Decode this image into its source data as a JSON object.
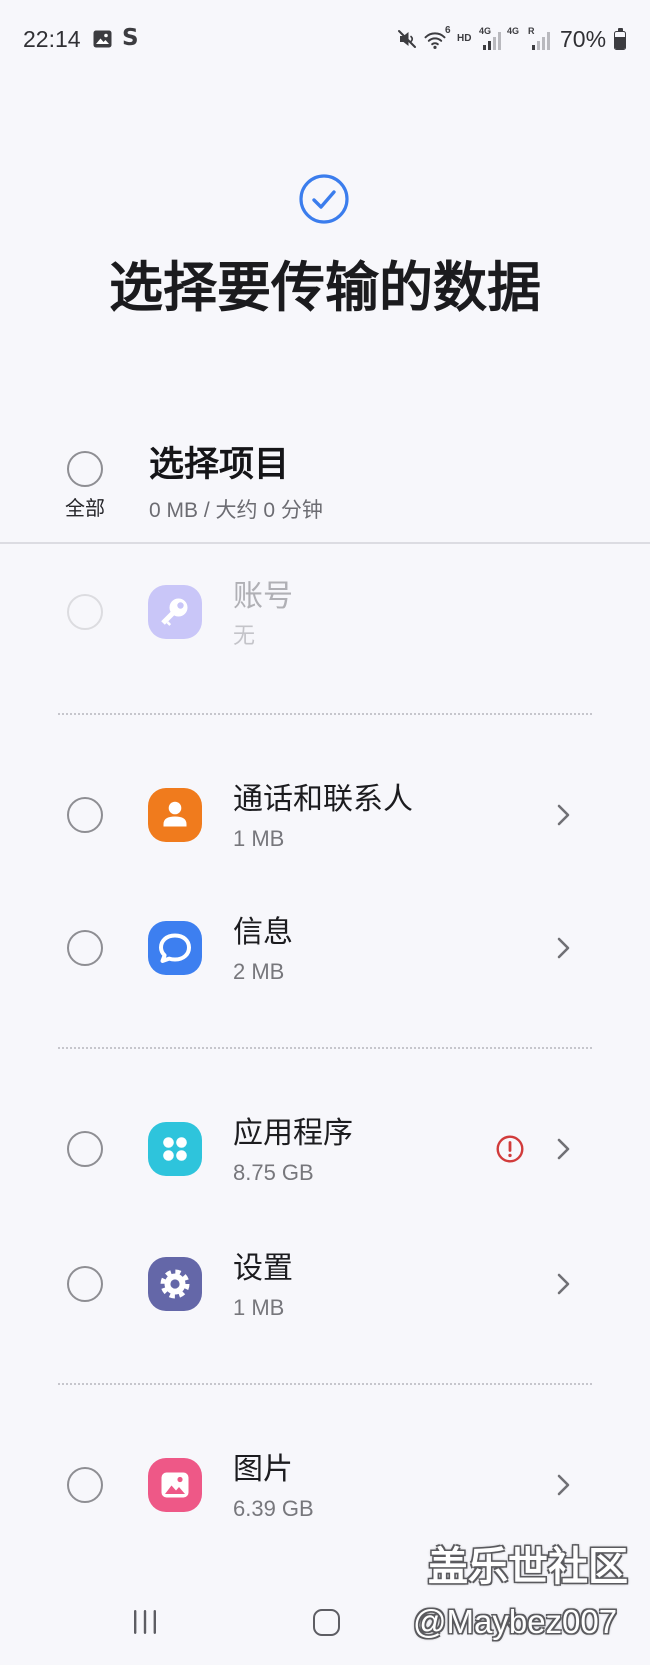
{
  "theme": {
    "background": "#f7f7fb",
    "accent": "#3b7ded",
    "warning": "#d13b3b"
  },
  "status_bar": {
    "time": "22:14",
    "notification_icons": [
      "image-notification-icon",
      "s-notification-icon"
    ],
    "s_icon_glyph": "S",
    "system_icons": [
      "mute-icon",
      "wifi-icon",
      "signal-icon",
      "signal-icon",
      "battery-icon"
    ],
    "wifi_standard": "6",
    "hd_label": "HD",
    "sim1_network": "4G",
    "sim2_network": "4G",
    "sim2_roaming": "R",
    "battery_text": "70%",
    "battery_level": 0.7
  },
  "header": {
    "icon": "check-circle-icon",
    "title": "选择要传输的数据"
  },
  "select_all": {
    "checked": false,
    "checkbox_label": "全部",
    "title": "选择项目",
    "summary": "0 MB / 大约 0 分钟"
  },
  "groups": [
    {
      "items": [
        {
          "label": "账号",
          "size": "无",
          "icon": "key-icon",
          "icon_bg": "#c9c6f8",
          "checked": false,
          "enabled": false,
          "has_detail": false
        }
      ]
    },
    {
      "items": [
        {
          "label": "通话和联系人",
          "size": "1 MB",
          "icon": "contacts-icon",
          "icon_bg": "#f07b1d",
          "checked": false,
          "enabled": true,
          "has_detail": true
        },
        {
          "label": "信息",
          "size": "2 MB",
          "icon": "messages-icon",
          "icon_bg": "#3d7ff0",
          "checked": false,
          "enabled": true,
          "has_detail": true
        }
      ]
    },
    {
      "items": [
        {
          "label": "应用程序",
          "size": "8.75 GB",
          "icon": "apps-icon",
          "icon_bg": "#2ec4dc",
          "checked": false,
          "enabled": true,
          "has_detail": true,
          "status_icon": "warning-icon"
        },
        {
          "label": "设置",
          "size": "1 MB",
          "icon": "settings-icon",
          "icon_bg": "#6467a8",
          "checked": false,
          "enabled": true,
          "has_detail": true
        }
      ]
    },
    {
      "items": [
        {
          "label": "图片",
          "size": "6.39 GB",
          "icon": "gallery-icon",
          "icon_bg": "#ee5887",
          "checked": false,
          "enabled": true,
          "has_detail": true
        }
      ]
    }
  ],
  "nav_bar": {
    "buttons": [
      "recent-apps-icon",
      "home-icon",
      "back-icon"
    ]
  },
  "watermark": {
    "site": "盖乐世社区",
    "handle": "@Maybez007"
  }
}
